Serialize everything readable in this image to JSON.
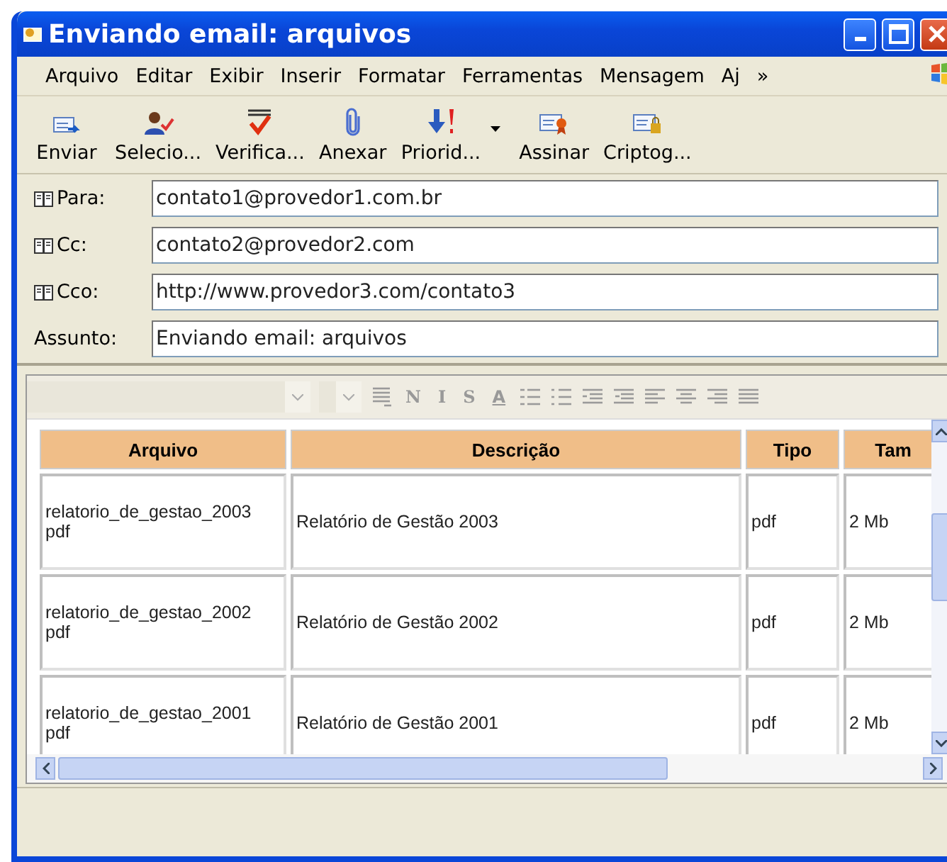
{
  "window": {
    "title": "Enviando email: arquivos"
  },
  "menu": [
    "Arquivo",
    "Editar",
    "Exibir",
    "Inserir",
    "Formatar",
    "Ferramentas",
    "Mensagem",
    "Aj",
    "»"
  ],
  "toolbar": [
    {
      "kind": "send",
      "label": "Enviar",
      "dropdown": false
    },
    {
      "kind": "person",
      "label": "Selecio...",
      "dropdown": false
    },
    {
      "kind": "spell",
      "label": "Verifica...",
      "dropdown": false
    },
    {
      "kind": "clip",
      "label": "Anexar",
      "dropdown": false
    },
    {
      "kind": "priority",
      "label": "Priorid...",
      "dropdown": true
    },
    {
      "kind": "sign",
      "label": "Assinar",
      "dropdown": false
    },
    {
      "kind": "encrypt",
      "label": "Criptog...",
      "dropdown": false
    }
  ],
  "headers": [
    {
      "label": "Para:",
      "book": true,
      "value": "contato1@provedor1.com.br"
    },
    {
      "label": "Cc:",
      "book": true,
      "value": "contato2@provedor2.com"
    },
    {
      "label": "Cco:",
      "book": true,
      "value": "http://www.provedor3.com/contato3"
    },
    {
      "label": "Assunto:",
      "book": false,
      "value": "Enviando email: arquivos"
    }
  ],
  "format_bar": [
    {
      "kind": "paragraph"
    },
    {
      "kind": "letter",
      "label": "N"
    },
    {
      "kind": "letter",
      "label": "I"
    },
    {
      "kind": "letter",
      "label": "S"
    },
    {
      "kind": "color",
      "label": "A"
    },
    {
      "kind": "numbered"
    },
    {
      "kind": "bullets"
    },
    {
      "kind": "outdent"
    },
    {
      "kind": "indent"
    },
    {
      "kind": "left"
    },
    {
      "kind": "center"
    },
    {
      "kind": "right"
    },
    {
      "kind": "justify"
    }
  ],
  "table": {
    "columns": [
      "Arquivo",
      "Descrição",
      "Tipo",
      "Tam"
    ],
    "rows": [
      [
        "relatorio_de_gestao_2003 pdf",
        "Relatório de Gestão 2003",
        "pdf",
        "2 Mb"
      ],
      [
        "relatorio_de_gestao_2002 pdf",
        "Relatório de Gestão 2002",
        "pdf",
        "2 Mb"
      ],
      [
        "relatorio_de_gestao_2001 pdf",
        "Relatório de Gestão 2001",
        "pdf",
        "2 Mb"
      ]
    ]
  }
}
